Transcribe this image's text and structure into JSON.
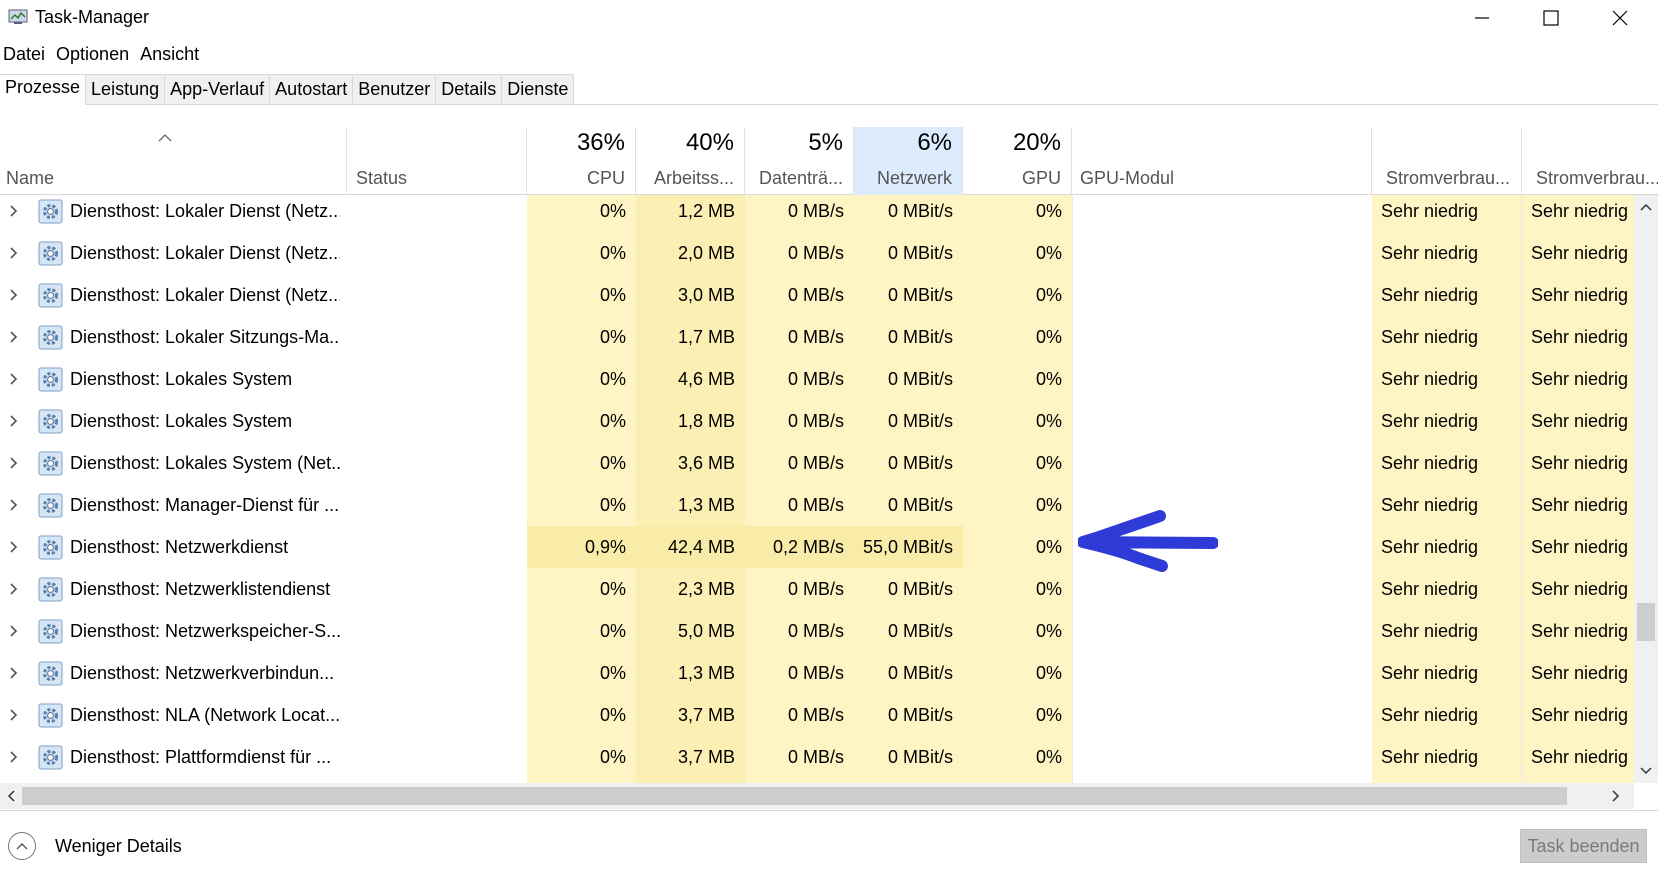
{
  "window": {
    "title": "Task-Manager"
  },
  "menu": [
    "Datei",
    "Optionen",
    "Ansicht"
  ],
  "tabs": [
    "Prozesse",
    "Leistung",
    "App-Verlauf",
    "Autostart",
    "Benutzer",
    "Details",
    "Dienste"
  ],
  "columns": {
    "name": "Name",
    "status": "Status",
    "cpu": {
      "pct": "36%",
      "label": "CPU"
    },
    "mem": {
      "pct": "40%",
      "label": "Arbeitss..."
    },
    "disk": {
      "pct": "5%",
      "label": "Datenträ..."
    },
    "net": {
      "pct": "6%",
      "label": "Netzwerk"
    },
    "gpu": {
      "pct": "20%",
      "label": "GPU"
    },
    "gpu_engine": "GPU-Modul",
    "power": "Stromverbrau...",
    "power_trend": "Stromverbrau..."
  },
  "rows": [
    {
      "name": "Diensthost: Lokaler Dienst (Netz...",
      "cpu": "0%",
      "mem": "1,2 MB",
      "disk": "0 MB/s",
      "net": "0 MBit/s",
      "gpu": "0%",
      "power": "Sehr niedrig",
      "trend": "Sehr niedrig"
    },
    {
      "name": "Diensthost: Lokaler Dienst (Netz...",
      "cpu": "0%",
      "mem": "2,0 MB",
      "disk": "0 MB/s",
      "net": "0 MBit/s",
      "gpu": "0%",
      "power": "Sehr niedrig",
      "trend": "Sehr niedrig"
    },
    {
      "name": "Diensthost: Lokaler Dienst (Netz...",
      "cpu": "0%",
      "mem": "3,0 MB",
      "disk": "0 MB/s",
      "net": "0 MBit/s",
      "gpu": "0%",
      "power": "Sehr niedrig",
      "trend": "Sehr niedrig"
    },
    {
      "name": "Diensthost: Lokaler Sitzungs-Ma...",
      "cpu": "0%",
      "mem": "1,7 MB",
      "disk": "0 MB/s",
      "net": "0 MBit/s",
      "gpu": "0%",
      "power": "Sehr niedrig",
      "trend": "Sehr niedrig"
    },
    {
      "name": "Diensthost: Lokales System",
      "cpu": "0%",
      "mem": "4,6 MB",
      "disk": "0 MB/s",
      "net": "0 MBit/s",
      "gpu": "0%",
      "power": "Sehr niedrig",
      "trend": "Sehr niedrig"
    },
    {
      "name": "Diensthost: Lokales System",
      "cpu": "0%",
      "mem": "1,8 MB",
      "disk": "0 MB/s",
      "net": "0 MBit/s",
      "gpu": "0%",
      "power": "Sehr niedrig",
      "trend": "Sehr niedrig"
    },
    {
      "name": "Diensthost: Lokales System (Net...",
      "cpu": "0%",
      "mem": "3,6 MB",
      "disk": "0 MB/s",
      "net": "0 MBit/s",
      "gpu": "0%",
      "power": "Sehr niedrig",
      "trend": "Sehr niedrig"
    },
    {
      "name": "Diensthost: Manager-Dienst für ...",
      "cpu": "0%",
      "mem": "1,3 MB",
      "disk": "0 MB/s",
      "net": "0 MBit/s",
      "gpu": "0%",
      "power": "Sehr niedrig",
      "trend": "Sehr niedrig"
    },
    {
      "name": "Diensthost: Netzwerkdienst",
      "cpu": "0,9%",
      "mem": "42,4 MB",
      "disk": "0,2 MB/s",
      "net": "55,0 MBit/s",
      "gpu": "0%",
      "power": "Sehr niedrig",
      "trend": "Sehr niedrig"
    },
    {
      "name": "Diensthost: Netzwerklistendienst",
      "cpu": "0%",
      "mem": "2,3 MB",
      "disk": "0 MB/s",
      "net": "0 MBit/s",
      "gpu": "0%",
      "power": "Sehr niedrig",
      "trend": "Sehr niedrig"
    },
    {
      "name": "Diensthost: Netzwerkspeicher-S...",
      "cpu": "0%",
      "mem": "5,0 MB",
      "disk": "0 MB/s",
      "net": "0 MBit/s",
      "gpu": "0%",
      "power": "Sehr niedrig",
      "trend": "Sehr niedrig"
    },
    {
      "name": "Diensthost: Netzwerkverbindun...",
      "cpu": "0%",
      "mem": "1,3 MB",
      "disk": "0 MB/s",
      "net": "0 MBit/s",
      "gpu": "0%",
      "power": "Sehr niedrig",
      "trend": "Sehr niedrig"
    },
    {
      "name": "Diensthost: NLA (Network Locat...",
      "cpu": "0%",
      "mem": "3,7 MB",
      "disk": "0 MB/s",
      "net": "0 MBit/s",
      "gpu": "0%",
      "power": "Sehr niedrig",
      "trend": "Sehr niedrig"
    },
    {
      "name": "Diensthost: Plattformdienst für ...",
      "cpu": "0%",
      "mem": "3,7 MB",
      "disk": "0 MB/s",
      "net": "0 MBit/s",
      "gpu": "0%",
      "power": "Sehr niedrig",
      "trend": "Sehr niedrig"
    }
  ],
  "footer": {
    "less_details": "Weniger Details",
    "end_task": "Task beenden"
  },
  "colors": {
    "usage_light": "#fff4c4",
    "usage_mid": "#fcefb4",
    "usage_highlight": "#f9eca8",
    "selected_header": "#dcecfc",
    "annotation": "#2f3bd6"
  }
}
